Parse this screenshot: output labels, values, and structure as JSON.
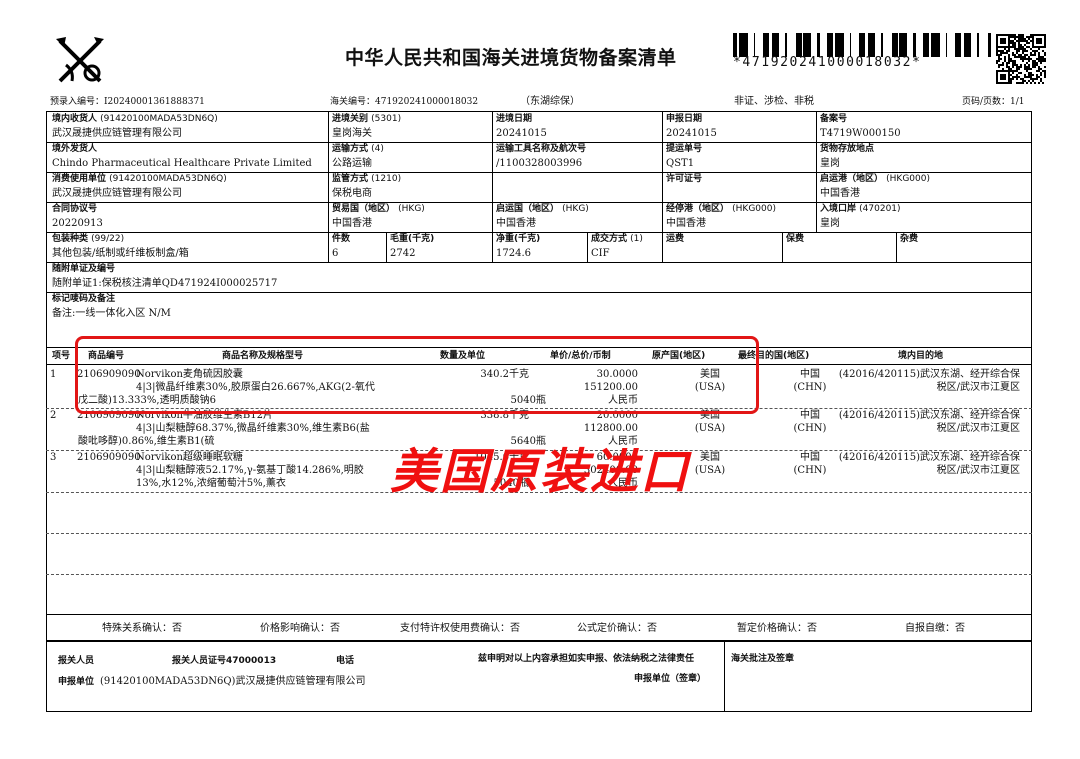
{
  "header": {
    "title": "中华人民共和国海关进境货物备案清单",
    "barcode_number": "*471920241000018032*",
    "pre_entry_no": "预录入编号：I20240001361888371",
    "customs_no": "海关编号：471920241000018032",
    "customs_district": "（东湖综保）",
    "flags": "非证、涉检、非税",
    "page": "页码/页数：1/1"
  },
  "icons": {
    "logo": "customs-emblem-icon",
    "barcode": "barcode-icon",
    "qr": "qr-code-icon"
  },
  "fields": {
    "consignee_label": "境内收货人",
    "consignee_code": "(91420100MADA53DN6Q)",
    "consignee_name": "武汉晟捷供应链管理有限公司",
    "entry_port_label": "进境关别",
    "entry_port_code": "(5301)",
    "entry_port": "皇岗海关",
    "entry_date_label": "进境日期",
    "entry_date": "20241015",
    "decl_date_label": "申报日期",
    "decl_date": "20241015",
    "record_no_label": "备案号",
    "record_no": "T4719W000150",
    "shipper_label": "境外发货人",
    "shipper": "Chindo Pharmaceutical Healthcare Private Limited",
    "transport_mode_label": "运输方式",
    "transport_mode_code": "(4)",
    "transport_mode": "公路运输",
    "vehicle_label": "运输工具名称及航次号",
    "vehicle": "/1100328003996",
    "bill_label": "提运单号",
    "bill": "QST1",
    "storage_label": "货物存放地点",
    "storage": "皇岗",
    "consumer_label": "消费使用单位",
    "consumer_code": "(91420100MADA53DN6Q)",
    "consumer_name": "武汉晟捷供应链管理有限公司",
    "supervision_label": "监管方式",
    "supervision_code": "(1210)",
    "supervision": "保税电商",
    "license_label": "许可证号",
    "license": "",
    "departure_port_label": "启运港（地区）",
    "departure_port_code": "(HKG000)",
    "departure_port": "中国香港",
    "contract_label": "合同协议号",
    "contract": "20220913",
    "trade_country_label": "贸易国（地区）",
    "trade_country_code": "(HKG)",
    "trade_country": "中国香港",
    "origin_country_label": "启运国（地区）",
    "origin_country_code": "(HKG)",
    "origin_country": "中国香港",
    "via_port_label": "经停港（地区）",
    "via_port_code": "(HKG000)",
    "via_port": "中国香港",
    "entry_border_label": "入境口岸",
    "entry_border_code": "(470201)",
    "entry_border": "皇岗",
    "package_label": "包装种类",
    "package_code": "(99/22)",
    "package": "其他包装/纸制或纤维板制盒/箱",
    "pieces_label": "件数",
    "pieces": "6",
    "gross_label": "毛重(千克)",
    "gross": "2742",
    "net_label": "净重(千克)",
    "net": "1724.6",
    "deal_label": "成交方式",
    "deal_code": "(1)",
    "deal": "CIF",
    "freight_label": "运费",
    "insurance_label": "保费",
    "misc_label": "杂费",
    "docs_label": "随附单证及编号",
    "docs": "随附单证1:保税核注清单QD471924I000025717",
    "marks_label": "标记唛码及备注",
    "marks": "备注:一线一体化入区 N/M"
  },
  "goods_header": {
    "no": "项号",
    "code": "商品编号",
    "name": "商品名称及规格型号",
    "qty": "数量及单位",
    "price": "单价/总价/币制",
    "origin": "原产国(地区)",
    "final_dest": "最终目的国(地区)",
    "domestic_dest": "境内目的地"
  },
  "goods": [
    {
      "no": "1",
      "code": "2106909090",
      "name": "Norvikon麦角硫因胶囊",
      "spec1": "4|3|微晶纤维素30%,胶原蛋白26.667%,AKG(2-氧代",
      "spec2": "戊二酸)13.333%,透明质酸钠6",
      "qty1": "340.2千克",
      "qty2": "5040瓶",
      "unit_price": "30.0000",
      "total_price": "151200.00",
      "currency": "人民币",
      "origin": "美国",
      "origin_code": "(USA)",
      "dest_country": "中国",
      "dest_country_code": "(CHN)",
      "domestic1": "(42016/420115)武汉东湖、经开综合保",
      "domestic2": "税区/武汉市江夏区"
    },
    {
      "no": "2",
      "code": "2106909090",
      "name": "Norvikon牛油胶维生素B12片",
      "spec1": "4|3|山梨糖醇68.37%,微晶纤维素30%,维生素B6(盐",
      "spec2": "酸吡哆醇)0.86%,维生素B1(硫",
      "qty1": "338.8千克",
      "qty2": "5640瓶",
      "unit_price": "20.0000",
      "total_price": "112800.00",
      "currency": "人民币",
      "origin": "美国",
      "origin_code": "(USA)",
      "dest_country": "中国",
      "dest_country_code": "(CHN)",
      "domestic1": "(42016/420115)武汉东湖、经开综合保",
      "domestic2": "税区/武汉市江夏区"
    },
    {
      "no": "3",
      "code": "2106909090",
      "name": "Norvikon超级睡眠软糖",
      "spec1": "4|3|山梨糖醇液52.17%,γ-氨基丁酸14.286%,明胶",
      "spec2": "13%,水12%,浓缩葡萄汁5%,薰衣",
      "qty1": "1045.6千克",
      "qty2": "5040瓶",
      "unit_price": "60.0000",
      "total_price": "302400.00",
      "currency": "人民币",
      "origin": "美国",
      "origin_code": "(USA)",
      "dest_country": "中国",
      "dest_country_code": "(CHN)",
      "domestic1": "(42016/420115)武汉东湖、经开综合保",
      "domestic2": "税区/武汉市江夏区"
    }
  ],
  "confirm": {
    "special": "特殊关系确认：否",
    "price_impact": "价格影响确认：否",
    "royalty": "支付特许权使用费确认：否",
    "formula": "公式定价确认：否",
    "provisional": "暂定价格确认：否",
    "self_pay": "自报自缴：否"
  },
  "footer": {
    "declarant": "报关人员",
    "declarant_cert": "报关人员证号47000013",
    "phone": "电话",
    "statement": "兹申明对以上内容承担如实申报、依法纳税之法律责任",
    "customs_sign": "海关批注及签章",
    "decl_unit": "申报单位",
    "decl_unit_name": "(91420100MADA53DN6Q)武汉晟捷供应链管理有限公司",
    "decl_seal": "申报单位（签章）"
  },
  "annotation": {
    "text": "美国原装进口",
    "color": "#f01010"
  }
}
